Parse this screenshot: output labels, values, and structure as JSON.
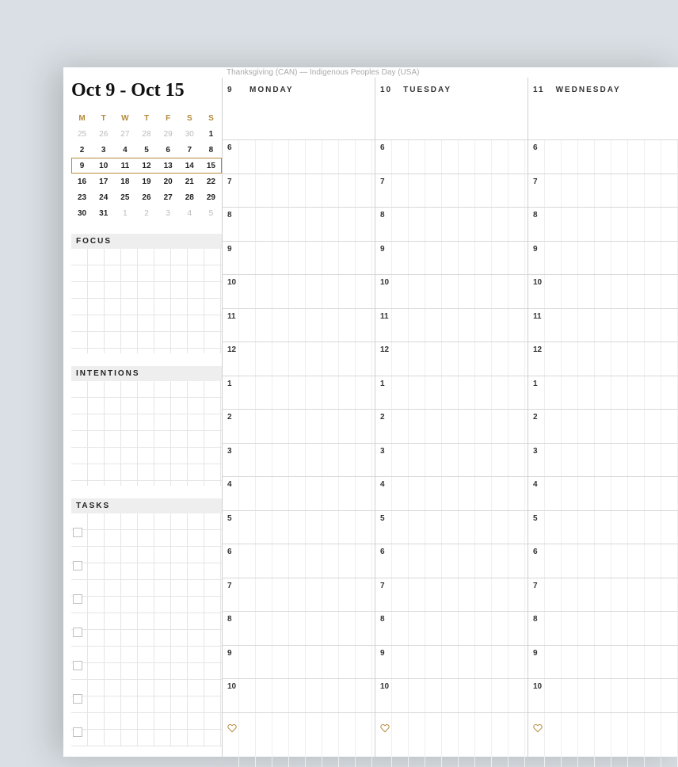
{
  "title": "Oct 9 - Oct 15",
  "holiday": "Thanksgiving (CAN) — Indigenous Peoples Day (USA)",
  "mini_cal": {
    "headers": [
      "M",
      "T",
      "W",
      "T",
      "F",
      "S",
      "S"
    ],
    "weeks": [
      {
        "cells": [
          {
            "d": "25",
            "m": true
          },
          {
            "d": "26",
            "m": true
          },
          {
            "d": "27",
            "m": true
          },
          {
            "d": "28",
            "m": true
          },
          {
            "d": "29",
            "m": true
          },
          {
            "d": "30",
            "m": true
          },
          {
            "d": "1"
          }
        ]
      },
      {
        "cells": [
          {
            "d": "2"
          },
          {
            "d": "3"
          },
          {
            "d": "4"
          },
          {
            "d": "5"
          },
          {
            "d": "6"
          },
          {
            "d": "7"
          },
          {
            "d": "8"
          }
        ]
      },
      {
        "cells": [
          {
            "d": "9"
          },
          {
            "d": "10"
          },
          {
            "d": "11"
          },
          {
            "d": "12"
          },
          {
            "d": "13"
          },
          {
            "d": "14"
          },
          {
            "d": "15"
          }
        ],
        "current": true
      },
      {
        "cells": [
          {
            "d": "16"
          },
          {
            "d": "17"
          },
          {
            "d": "18"
          },
          {
            "d": "19"
          },
          {
            "d": "20"
          },
          {
            "d": "21"
          },
          {
            "d": "22"
          }
        ]
      },
      {
        "cells": [
          {
            "d": "23"
          },
          {
            "d": "24"
          },
          {
            "d": "25"
          },
          {
            "d": "26"
          },
          {
            "d": "27"
          },
          {
            "d": "28"
          },
          {
            "d": "29"
          }
        ]
      },
      {
        "cells": [
          {
            "d": "30"
          },
          {
            "d": "31"
          },
          {
            "d": "1",
            "m": true
          },
          {
            "d": "2",
            "m": true
          },
          {
            "d": "3",
            "m": true
          },
          {
            "d": "4",
            "m": true
          },
          {
            "d": "5",
            "m": true
          }
        ]
      }
    ]
  },
  "sections": {
    "focus": "FOCUS",
    "intentions": "INTENTIONS",
    "tasks": "TASKS"
  },
  "task_count": 7,
  "days": [
    {
      "num": "9",
      "name": "MONDAY"
    },
    {
      "num": "10",
      "name": "TUESDAY"
    },
    {
      "num": "11",
      "name": "WEDNESDAY"
    }
  ],
  "hours": [
    "6",
    "7",
    "8",
    "9",
    "10",
    "11",
    "12",
    "1",
    "2",
    "3",
    "4",
    "5",
    "6",
    "7",
    "8",
    "9",
    "10"
  ]
}
